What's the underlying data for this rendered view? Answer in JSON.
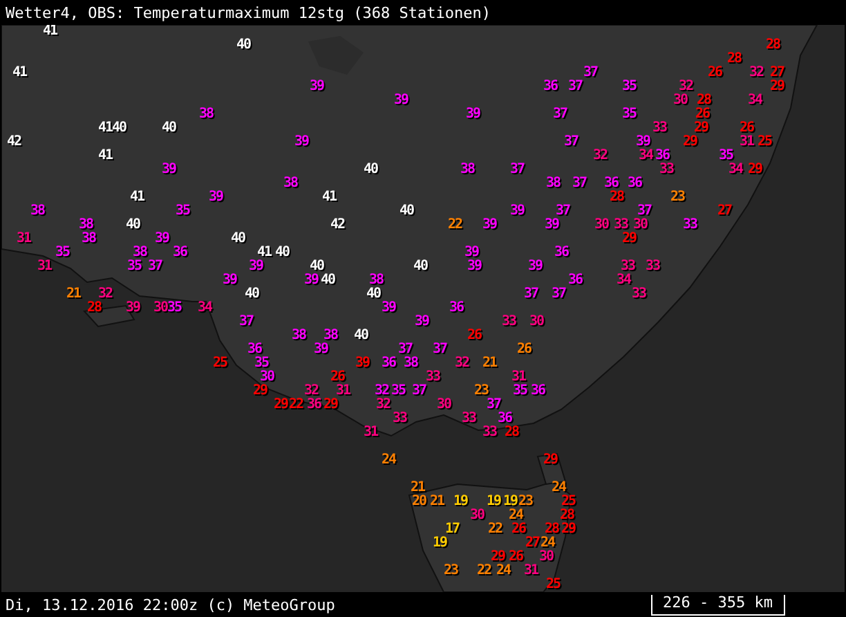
{
  "title": "Wetter4, OBS: Temperaturmaximum 12stg (368 Stationen)",
  "stations": [
    {
      "value": "41",
      "color": "#ffffff"
    },
    {
      "value": "40",
      "color": "#ffffff"
    },
    {
      "value": "28",
      "color": "#ff0000"
    },
    {
      "value": "28",
      "color": "#ff0000"
    },
    {
      "value": "41",
      "color": "#ffffff"
    },
    {
      "value": "37",
      "color": "#ff00ff"
    },
    {
      "value": "26",
      "color": "#ff0000"
    },
    {
      "value": "32",
      "color": "#ff0080"
    },
    {
      "value": "27",
      "color": "#ff0000"
    },
    {
      "value": "39",
      "color": "#ff00ff"
    },
    {
      "value": "36",
      "color": "#ff00ff"
    },
    {
      "value": "37",
      "color": "#ff00ff"
    },
    {
      "value": "35",
      "color": "#ff00ff"
    },
    {
      "value": "32",
      "color": "#ff0080"
    },
    {
      "value": "29",
      "color": "#ff0000"
    },
    {
      "value": "39",
      "color": "#ff00ff"
    },
    {
      "value": "30",
      "color": "#ff0080"
    },
    {
      "value": "28",
      "color": "#ff0000"
    },
    {
      "value": "34",
      "color": "#ff0080"
    },
    {
      "value": "38",
      "color": "#ff00ff"
    },
    {
      "value": "39",
      "color": "#ff00ff"
    },
    {
      "value": "37",
      "color": "#ff00ff"
    },
    {
      "value": "35",
      "color": "#ff00ff"
    },
    {
      "value": "26",
      "color": "#ff0000"
    },
    {
      "value": "41",
      "color": "#ffffff"
    },
    {
      "value": "40",
      "color": "#ffffff"
    },
    {
      "value": "40",
      "color": "#ffffff"
    },
    {
      "value": "33",
      "color": "#ff0080"
    },
    {
      "value": "29",
      "color": "#ff0000"
    },
    {
      "value": "26",
      "color": "#ff0000"
    },
    {
      "value": "42",
      "color": "#ffffff"
    },
    {
      "value": "39",
      "color": "#ff00ff"
    },
    {
      "value": "37",
      "color": "#ff00ff"
    },
    {
      "value": "39",
      "color": "#ff00ff"
    },
    {
      "value": "29",
      "color": "#ff0000"
    },
    {
      "value": "31",
      "color": "#ff0080"
    },
    {
      "value": "25",
      "color": "#ff0000"
    },
    {
      "value": "41",
      "color": "#ffffff"
    },
    {
      "value": "32",
      "color": "#ff0080"
    },
    {
      "value": "34",
      "color": "#ff0080"
    },
    {
      "value": "36",
      "color": "#ff00ff"
    },
    {
      "value": "35",
      "color": "#ff00ff"
    },
    {
      "value": "39",
      "color": "#ff00ff"
    },
    {
      "value": "40",
      "color": "#ffffff"
    },
    {
      "value": "38",
      "color": "#ff00ff"
    },
    {
      "value": "37",
      "color": "#ff00ff"
    },
    {
      "value": "33",
      "color": "#ff0080"
    },
    {
      "value": "34",
      "color": "#ff0080"
    },
    {
      "value": "29",
      "color": "#ff0000"
    },
    {
      "value": "38",
      "color": "#ff00ff"
    },
    {
      "value": "38",
      "color": "#ff00ff"
    },
    {
      "value": "37",
      "color": "#ff00ff"
    },
    {
      "value": "36",
      "color": "#ff00ff"
    },
    {
      "value": "36",
      "color": "#ff00ff"
    },
    {
      "value": "41",
      "color": "#ffffff"
    },
    {
      "value": "39",
      "color": "#ff00ff"
    },
    {
      "value": "41",
      "color": "#ffffff"
    },
    {
      "value": "28",
      "color": "#ff0000"
    },
    {
      "value": "23",
      "color": "#ff8000"
    },
    {
      "value": "38",
      "color": "#ff00ff"
    },
    {
      "value": "35",
      "color": "#ff00ff"
    },
    {
      "value": "40",
      "color": "#ffffff"
    },
    {
      "value": "39",
      "color": "#ff00ff"
    },
    {
      "value": "37",
      "color": "#ff00ff"
    },
    {
      "value": "37",
      "color": "#ff00ff"
    },
    {
      "value": "27",
      "color": "#ff0000"
    },
    {
      "value": "38",
      "color": "#ff00ff"
    },
    {
      "value": "40",
      "color": "#ffffff"
    },
    {
      "value": "42",
      "color": "#ffffff"
    },
    {
      "value": "22",
      "color": "#ff8000"
    },
    {
      "value": "39",
      "color": "#ff00ff"
    },
    {
      "value": "39",
      "color": "#ff00ff"
    },
    {
      "value": "30",
      "color": "#ff0080"
    },
    {
      "value": "33",
      "color": "#ff0080"
    },
    {
      "value": "30",
      "color": "#ff0080"
    },
    {
      "value": "33",
      "color": "#ff00ff"
    },
    {
      "value": "31",
      "color": "#ff0080"
    },
    {
      "value": "38",
      "color": "#ff00ff"
    },
    {
      "value": "39",
      "color": "#ff00ff"
    },
    {
      "value": "40",
      "color": "#ffffff"
    },
    {
      "value": "29",
      "color": "#ff0000"
    },
    {
      "value": "35",
      "color": "#ff00ff"
    },
    {
      "value": "38",
      "color": "#ff00ff"
    },
    {
      "value": "36",
      "color": "#ff00ff"
    },
    {
      "value": "41",
      "color": "#ffffff"
    },
    {
      "value": "40",
      "color": "#ffffff"
    },
    {
      "value": "39",
      "color": "#ff00ff"
    },
    {
      "value": "36",
      "color": "#ff00ff"
    },
    {
      "value": "31",
      "color": "#ff0080"
    },
    {
      "value": "35",
      "color": "#ff00ff"
    },
    {
      "value": "37",
      "color": "#ff00ff"
    },
    {
      "value": "39",
      "color": "#ff00ff"
    },
    {
      "value": "40",
      "color": "#ffffff"
    },
    {
      "value": "40",
      "color": "#ffffff"
    },
    {
      "value": "39",
      "color": "#ff00ff"
    },
    {
      "value": "39",
      "color": "#ff00ff"
    },
    {
      "value": "33",
      "color": "#ff0080"
    },
    {
      "value": "33",
      "color": "#ff0080"
    },
    {
      "value": "39",
      "color": "#ff00ff"
    },
    {
      "value": "39",
      "color": "#ff00ff"
    },
    {
      "value": "40",
      "color": "#ffffff"
    },
    {
      "value": "38",
      "color": "#ff00ff"
    },
    {
      "value": "36",
      "color": "#ff00ff"
    },
    {
      "value": "34",
      "color": "#ff0080"
    },
    {
      "value": "21",
      "color": "#ff8000"
    },
    {
      "value": "32",
      "color": "#ff0080"
    },
    {
      "value": "40",
      "color": "#ffffff"
    },
    {
      "value": "40",
      "color": "#ffffff"
    },
    {
      "value": "37",
      "color": "#ff00ff"
    },
    {
      "value": "37",
      "color": "#ff00ff"
    },
    {
      "value": "33",
      "color": "#ff0080"
    },
    {
      "value": "28",
      "color": "#ff0000"
    },
    {
      "value": "39",
      "color": "#ff0080"
    },
    {
      "value": "30",
      "color": "#ff0080"
    },
    {
      "value": "35",
      "color": "#ff00ff"
    },
    {
      "value": "34",
      "color": "#ff0080"
    },
    {
      "value": "39",
      "color": "#ff00ff"
    },
    {
      "value": "36",
      "color": "#ff00ff"
    },
    {
      "value": "37",
      "color": "#ff00ff"
    },
    {
      "value": "39",
      "color": "#ff00ff"
    },
    {
      "value": "33",
      "color": "#ff0080"
    },
    {
      "value": "30",
      "color": "#ff0080"
    },
    {
      "value": "38",
      "color": "#ff00ff"
    },
    {
      "value": "38",
      "color": "#ff00ff"
    },
    {
      "value": "40",
      "color": "#ffffff"
    },
    {
      "value": "26",
      "color": "#ff0000"
    },
    {
      "value": "36",
      "color": "#ff00ff"
    },
    {
      "value": "39",
      "color": "#ff00ff"
    },
    {
      "value": "37",
      "color": "#ff00ff"
    },
    {
      "value": "37",
      "color": "#ff00ff"
    },
    {
      "value": "26",
      "color": "#ff8000"
    },
    {
      "value": "25",
      "color": "#ff0000"
    },
    {
      "value": "35",
      "color": "#ff00ff"
    },
    {
      "value": "39",
      "color": "#ff0000"
    },
    {
      "value": "36",
      "color": "#ff00ff"
    },
    {
      "value": "38",
      "color": "#ff00ff"
    },
    {
      "value": "32",
      "color": "#ff0080"
    },
    {
      "value": "21",
      "color": "#ff8000"
    },
    {
      "value": "30",
      "color": "#ff00ff"
    },
    {
      "value": "26",
      "color": "#ff0000"
    },
    {
      "value": "33",
      "color": "#ff0080"
    },
    {
      "value": "31",
      "color": "#ff0080"
    },
    {
      "value": "29",
      "color": "#ff0000"
    },
    {
      "value": "32",
      "color": "#ff0080"
    },
    {
      "value": "31",
      "color": "#ff0080"
    },
    {
      "value": "32",
      "color": "#ff00ff"
    },
    {
      "value": "35",
      "color": "#ff00ff"
    },
    {
      "value": "37",
      "color": "#ff00ff"
    },
    {
      "value": "23",
      "color": "#ff8000"
    },
    {
      "value": "35",
      "color": "#ff00ff"
    },
    {
      "value": "36",
      "color": "#ff00ff"
    },
    {
      "value": "29",
      "color": "#ff0000"
    },
    {
      "value": "22",
      "color": "#ff0000"
    },
    {
      "value": "36",
      "color": "#ff0080"
    },
    {
      "value": "29",
      "color": "#ff0000"
    },
    {
      "value": "32",
      "color": "#ff0080"
    },
    {
      "value": "30",
      "color": "#ff0080"
    },
    {
      "value": "37",
      "color": "#ff00ff"
    },
    {
      "value": "33",
      "color": "#ff0080"
    },
    {
      "value": "33",
      "color": "#ff0080"
    },
    {
      "value": "36",
      "color": "#ff00ff"
    },
    {
      "value": "31",
      "color": "#ff0080"
    },
    {
      "value": "33",
      "color": "#ff0080"
    },
    {
      "value": "28",
      "color": "#ff0000"
    },
    {
      "value": "24",
      "color": "#ff8000"
    },
    {
      "value": "29",
      "color": "#ff0000"
    },
    {
      "value": "21",
      "color": "#ff8000"
    },
    {
      "value": "24",
      "color": "#ff8000"
    },
    {
      "value": "20",
      "color": "#ff8000"
    },
    {
      "value": "21",
      "color": "#ff8000"
    },
    {
      "value": "19",
      "color": "#ffcc00"
    },
    {
      "value": "19",
      "color": "#ffcc00"
    },
    {
      "value": "19",
      "color": "#ffcc00"
    },
    {
      "value": "23",
      "color": "#ff8000"
    },
    {
      "value": "25",
      "color": "#ff0000"
    },
    {
      "value": "30",
      "color": "#ff0080"
    },
    {
      "value": "24",
      "color": "#ff8000"
    },
    {
      "value": "28",
      "color": "#ff0000"
    },
    {
      "value": "17",
      "color": "#ffcc00"
    },
    {
      "value": "22",
      "color": "#ff8000"
    },
    {
      "value": "26",
      "color": "#ff0000"
    },
    {
      "value": "28",
      "color": "#ff0000"
    },
    {
      "value": "29",
      "color": "#ff0000"
    },
    {
      "value": "19",
      "color": "#ffcc00"
    },
    {
      "value": "27",
      "color": "#ff0000"
    },
    {
      "value": "24",
      "color": "#ff8000"
    },
    {
      "value": "29",
      "color": "#ff0000"
    },
    {
      "value": "26",
      "color": "#ff0000"
    },
    {
      "value": "30",
      "color": "#ff0080"
    },
    {
      "value": "23",
      "color": "#ff8000"
    },
    {
      "value": "22",
      "color": "#ff8000"
    },
    {
      "value": "24",
      "color": "#ff8000"
    },
    {
      "value": "31",
      "color": "#ff0080"
    },
    {
      "value": "25",
      "color": "#ff0000"
    }
  ],
  "footer": "Di, 13.12.2016 22:00z (c) MeteoGroup",
  "scale": "226 - 355 km"
}
